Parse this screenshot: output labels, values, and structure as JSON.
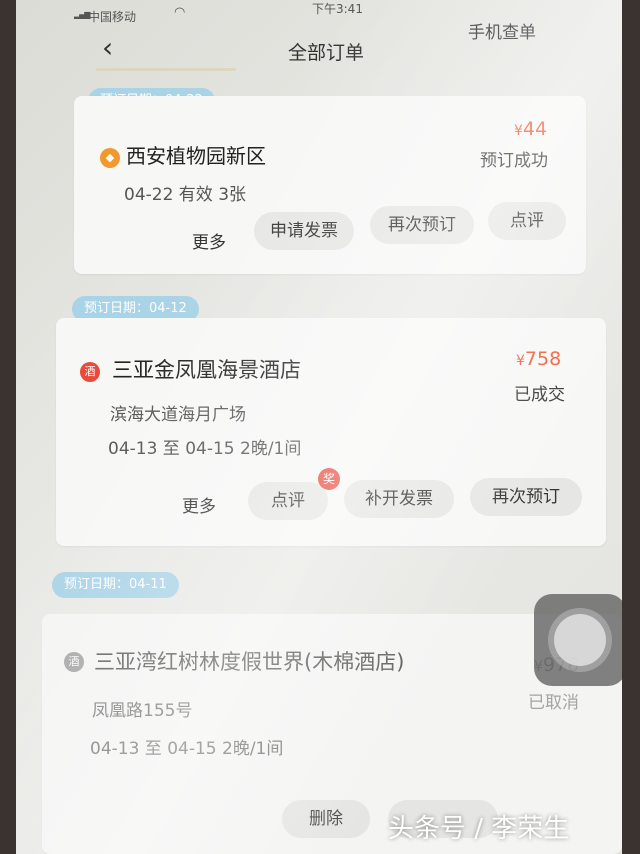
{
  "status_bar": {
    "carrier": "中国移动",
    "time": "下午3:41"
  },
  "header": {
    "title": "全部订单",
    "right_link": "手机查单"
  },
  "orders": [
    {
      "date_label": "预订日期：04-22",
      "name": "西安植物园新区",
      "details": [
        "04-22 有效 3张"
      ],
      "price": "44",
      "currency": "¥",
      "status": "预订成功",
      "more": "更多",
      "buttons": [
        "申请发票",
        "再次预订",
        "点评"
      ]
    },
    {
      "date_label": "预订日期：04-12",
      "name": "三亚金凤凰海景酒店",
      "details": [
        "滨海大道海月广场",
        "04-13 至 04-15  2晚/1间"
      ],
      "price": "758",
      "currency": "¥",
      "status": "已成交",
      "more": "更多",
      "buttons": [
        "点评",
        "补开发票",
        "再次预订"
      ],
      "award": "奖"
    },
    {
      "date_label": "预订日期：04-11",
      "name": "三亚湾红树林度假世界(木棉酒店)",
      "details": [
        "凤凰路155号",
        "04-13 至 04-15  2晚/1间"
      ],
      "price": "978",
      "currency": "¥",
      "status": "已取消",
      "buttons": [
        "删除"
      ]
    }
  ],
  "hotel_badge": "酒",
  "watermark": "头条号 / 李荣生",
  "colors": {
    "accent": "#ee5a36",
    "date_pill": "#a9d3e6",
    "button_bg": "#e6e6e4"
  }
}
